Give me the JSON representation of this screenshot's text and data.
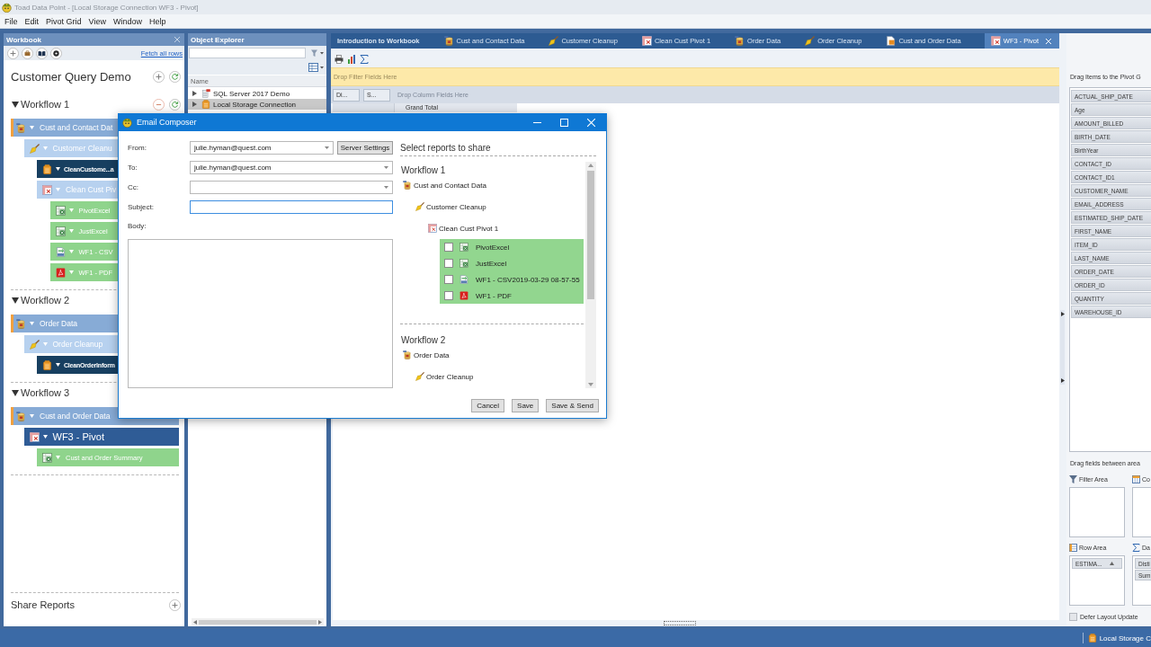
{
  "window": {
    "title": "Toad Data Point - [Local Storage Connection WF3 - Pivot]"
  },
  "menu": [
    "File",
    "Edit",
    "Pivot Grid",
    "View",
    "Window",
    "Help"
  ],
  "workbook": {
    "title": "Workbook",
    "link": "Fetch all rows",
    "name": "Customer Query Demo",
    "workflows": [
      {
        "title": "Workflow 1",
        "expanded": true,
        "items": [
          {
            "kind": "query",
            "label": "Cust and Contact Dat",
            "selected": false,
            "children": [
              {
                "kind": "cleanup",
                "label": "Customer Cleanu",
                "selected": false,
                "children": [
                  {
                    "kind": "storage",
                    "label": "CleanCustome...a",
                    "selected": false
                  },
                  {
                    "kind": "pivot",
                    "label": "Clean Cust Piv",
                    "selected": false,
                    "children": [
                      {
                        "kind": "excel",
                        "label": "PivotExcel",
                        "selected": false
                      },
                      {
                        "kind": "excel",
                        "label": "JustExcel",
                        "selected": false
                      },
                      {
                        "kind": "csv",
                        "label": "WF1 - CSV",
                        "selected": false
                      },
                      {
                        "kind": "pdf",
                        "label": "WF1 - PDF",
                        "selected": false
                      }
                    ]
                  }
                ]
              }
            ]
          }
        ]
      },
      {
        "title": "Workflow 2",
        "expanded": true,
        "items": [
          {
            "kind": "query",
            "label": "Order Data",
            "selected": false,
            "children": [
              {
                "kind": "cleanup",
                "label": "Order Cleanup",
                "selected": false,
                "children": [
                  {
                    "kind": "storage",
                    "label": "CleanOrderInform",
                    "selected": false
                  }
                ]
              }
            ]
          }
        ]
      },
      {
        "title": "Workflow 3",
        "expanded": true,
        "items": [
          {
            "kind": "query",
            "label": "Cust and Order Data",
            "selected": false,
            "children": [
              {
                "kind": "pivot",
                "label": "WF3 - Pivot",
                "selected": true,
                "children": [
                  {
                    "kind": "excel",
                    "label": "Cust and Order Summary",
                    "selected": false
                  }
                ]
              }
            ]
          }
        ]
      }
    ],
    "footer": "Share Reports"
  },
  "object_explorer": {
    "title": "Object Explorer",
    "column": "Name",
    "nodes": [
      {
        "kind": "server",
        "label": "SQL Server 2017 Demo",
        "expanded": false,
        "selected": false
      },
      {
        "kind": "storage",
        "label": "Local Storage Connection",
        "expanded": false,
        "selected": true
      }
    ]
  },
  "document": {
    "tabs": [
      {
        "label": "Introduction to Workbook",
        "kind": "intro",
        "selected": false
      },
      {
        "label": "Cust and Contact Data",
        "kind": "query",
        "selected": false
      },
      {
        "label": "Customer Cleanup",
        "kind": "cleanup",
        "selected": false
      },
      {
        "label": "Clean Cust Pivot 1",
        "kind": "pivot",
        "selected": false
      },
      {
        "label": "Order Data",
        "kind": "query",
        "selected": false
      },
      {
        "label": "Order Cleanup",
        "kind": "cleanup",
        "selected": false
      },
      {
        "label": "Cust and Order Data",
        "kind": "document",
        "selected": false
      },
      {
        "label": "WF3 - Pivot",
        "kind": "pivot",
        "selected": true
      }
    ],
    "pivot": {
      "filter_hint": "Drop Filter Fields Here",
      "data_fields": [
        "Di...",
        "S..."
      ],
      "column_hint": "Drop Column Fields Here",
      "column_header": "Grand Total"
    }
  },
  "field_list": {
    "title": "Drag Items to the Pivot G",
    "fields": [
      "ACTUAL_SHIP_DATE",
      "Age",
      "AMOUNT_BILLED",
      "BIRTH_DATE",
      "BirthYear",
      "CONTACT_ID",
      "CONTACT_ID1",
      "CUSTOMER_NAME",
      "EMAIL_ADDRESS",
      "ESTIMATED_SHIP_DATE",
      "FIRST_NAME",
      "ITEM_ID",
      "LAST_NAME",
      "ORDER_DATE",
      "ORDER_ID",
      "QUANTITY",
      "WAREHOUSE_ID"
    ],
    "areas_title": "Drag fields between area",
    "areas": [
      {
        "kind": "filter",
        "label": "Filter Area"
      },
      {
        "kind": "column",
        "label": "Co"
      },
      {
        "kind": "row",
        "label": "Row Area",
        "items": [
          "ESTIMA..."
        ]
      },
      {
        "kind": "data",
        "label": "Da",
        "items": [
          "Disti",
          "Sum"
        ]
      }
    ],
    "defer": {
      "label": "Defer Layout Update",
      "checked": false
    }
  },
  "status_bar": {
    "connection": "Local Storage C"
  },
  "email_dialog": {
    "title": "Email Composer",
    "fields": [
      {
        "label": "From:",
        "kind": "combo",
        "value": "julie.hyman@quest.com",
        "button": "Server Settings",
        "focused": false
      },
      {
        "label": "To:",
        "kind": "combo",
        "value": "julie.hyman@quest.com",
        "focused": false
      },
      {
        "label": "Cc:",
        "kind": "combo",
        "focused": false
      },
      {
        "label": "Subject:",
        "kind": "text",
        "focused": true
      }
    ],
    "body_label": "Body:",
    "reports_title": "Select reports to share",
    "workflows": [
      {
        "title": "Workflow 1",
        "items": [
          {
            "kind": "query",
            "label": "Cust and Contact Data",
            "children": [
              {
                "kind": "cleanup",
                "label": "Customer Cleanup",
                "children": [
                  {
                    "kind": "pivot",
                    "label": "Clean Cust Pivot 1",
                    "reports": [
                      {
                        "kind": "excel",
                        "label": "PivotExcel",
                        "checked": false
                      },
                      {
                        "kind": "excel",
                        "label": "JustExcel",
                        "checked": false
                      },
                      {
                        "kind": "csv",
                        "label": "WF1 - CSV2019-03-29 08-57-55",
                        "checked": false
                      },
                      {
                        "kind": "pdf",
                        "label": "WF1 - PDF",
                        "checked": false
                      }
                    ]
                  }
                ]
              }
            ]
          }
        ]
      },
      {
        "title": "Workflow 2",
        "items": [
          {
            "kind": "query",
            "label": "Order Data",
            "children": [
              {
                "kind": "cleanup",
                "label": "Order Cleanup"
              }
            ]
          }
        ]
      }
    ],
    "buttons": [
      "Cancel",
      "Save",
      "Save & Send"
    ]
  }
}
